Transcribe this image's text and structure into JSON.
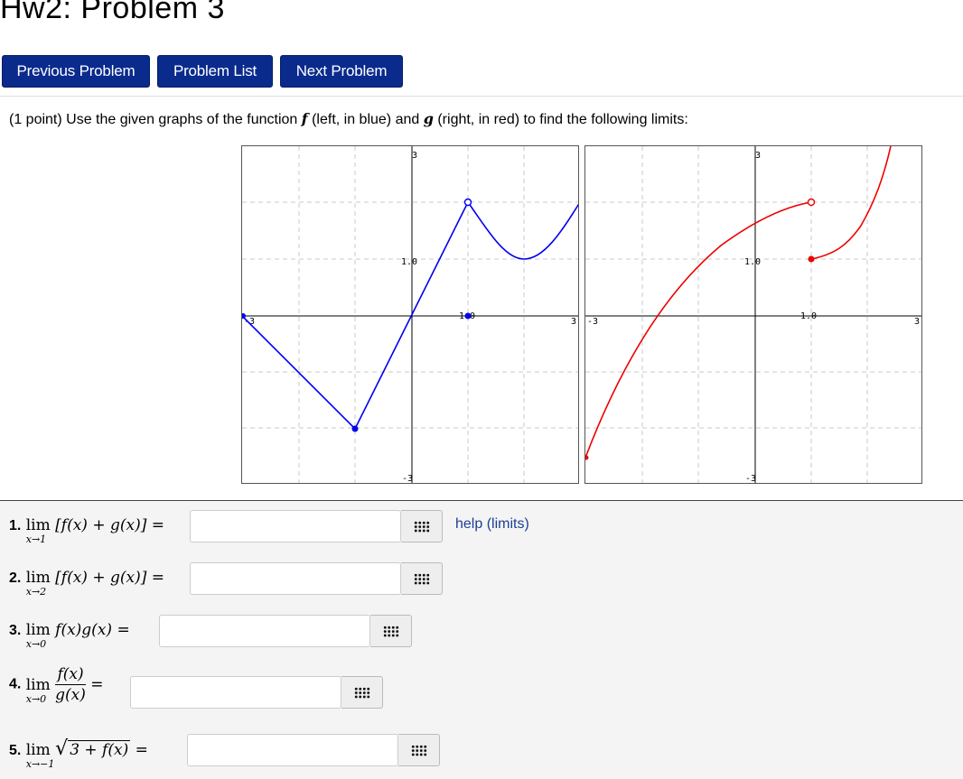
{
  "page": {
    "title": "Hw2: Problem 3"
  },
  "nav": {
    "previous": "Previous Problem",
    "list": "Problem List",
    "next": "Next Problem"
  },
  "problem": {
    "intro_start": "(1 point) Use the given graphs of the function ",
    "intro_f": "f",
    "intro_mid1": " (left, in blue) and ",
    "intro_g": "g",
    "intro_end": " (right, in red) to find the following limits:",
    "help_link": "help (limits)"
  },
  "graphs": {
    "colors": {
      "f": "#0000ee",
      "g": "#ee0000",
      "grid": "#c8c8c8",
      "axis": "#000000"
    },
    "left": {
      "axis_labels": {
        "ymax": "3",
        "ymin": "-3",
        "xmin": "-3",
        "xmax": "3",
        "xone": "1.0",
        "yone": "1.0"
      }
    },
    "right": {
      "axis_labels": {
        "ymax": "3",
        "ymin": "-3",
        "xmin": "-3",
        "xmax": "3",
        "xone": "1.0",
        "yone": "1.0"
      }
    }
  },
  "questions": [
    {
      "number": "1.",
      "sub": "x→1",
      "body": "[f(x) + g(x)] ="
    },
    {
      "number": "2.",
      "sub": "x→2",
      "body": "[f(x) + g(x)] ="
    },
    {
      "number": "3.",
      "sub": "x→0",
      "body": "f(x)g(x) ="
    },
    {
      "number": "4.",
      "sub": "x→0",
      "num": "f(x)",
      "den": "g(x)",
      "eq": "="
    },
    {
      "number": "5.",
      "sub": "x→−1",
      "radicand": "3 + f(x)",
      "eq": "="
    }
  ],
  "lim_word": "lim",
  "grid_icon": "matrix-grid-icon"
}
